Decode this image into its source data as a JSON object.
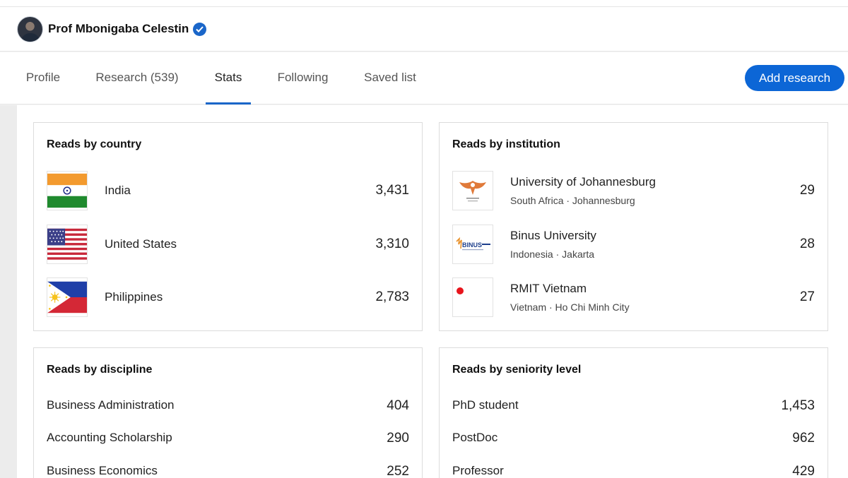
{
  "profile": {
    "name": "Prof Mbonigaba Celestin"
  },
  "tabs": [
    {
      "label": "Profile"
    },
    {
      "label": "Research (539)"
    },
    {
      "label": "Stats"
    },
    {
      "label": "Following"
    },
    {
      "label": "Saved list"
    }
  ],
  "add_button": "Add research",
  "reads_by_country": {
    "title": "Reads by country",
    "rows": [
      {
        "label": "India",
        "value": "3,431",
        "icon": "india-flag-icon"
      },
      {
        "label": "United States",
        "value": "3,310",
        "icon": "us-flag-icon"
      },
      {
        "label": "Philippines",
        "value": "2,783",
        "icon": "philippines-flag-icon"
      }
    ]
  },
  "reads_by_institution": {
    "title": "Reads by institution",
    "rows": [
      {
        "name": "University of Johannesburg",
        "location": "South Africa · Johannesburg",
        "value": "29",
        "icon": "uj-logo-icon"
      },
      {
        "name": "Binus University",
        "location": "Indonesia · Jakarta",
        "value": "28",
        "icon": "binus-logo-icon"
      },
      {
        "name": "RMIT Vietnam",
        "location": "Vietnam · Ho Chi Minh City",
        "value": "27",
        "icon": "rmit-logo-icon"
      }
    ]
  },
  "reads_by_discipline": {
    "title": "Reads by discipline",
    "rows": [
      {
        "label": "Business Administration",
        "value": "404"
      },
      {
        "label": "Accounting Scholarship",
        "value": "290"
      },
      {
        "label": "Business Economics",
        "value": "252"
      }
    ]
  },
  "reads_by_seniority": {
    "title": "Reads by seniority level",
    "rows": [
      {
        "label": "PhD student",
        "value": "1,453"
      },
      {
        "label": "PostDoc",
        "value": "962"
      },
      {
        "label": "Professor",
        "value": "429"
      }
    ]
  },
  "colors": {
    "accent": "#0c66d6",
    "verified": "#1a66c9"
  }
}
